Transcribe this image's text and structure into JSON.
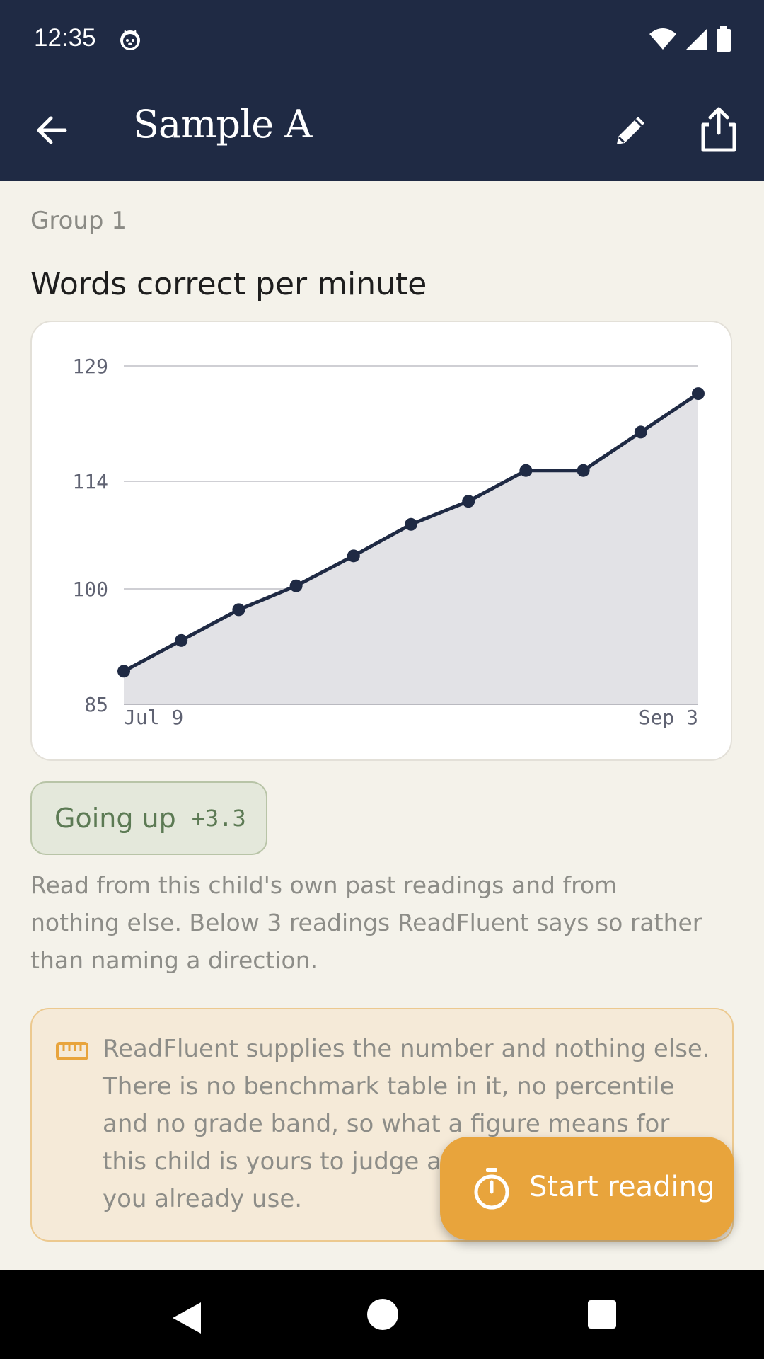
{
  "status": {
    "time": "12:35"
  },
  "appbar": {
    "title": "Sample A"
  },
  "group_label": "Group 1",
  "section_title": "Words correct per minute",
  "chart_data": {
    "type": "area",
    "title": "",
    "xlabel": "",
    "ylabel": "",
    "x_tick_labels": [
      "Jul 9",
      "Sep 3"
    ],
    "y_ticks": [
      85,
      100,
      114,
      129
    ],
    "ylim": [
      85,
      129
    ],
    "points": [
      {
        "x": "Jul 9",
        "y": 89.3
      },
      {
        "x": "Jul 14",
        "y": 93.3
      },
      {
        "x": "Jul 19",
        "y": 97.3
      },
      {
        "x": "Jul 24",
        "y": 100.4
      },
      {
        "x": "Jul 29",
        "y": 104.3
      },
      {
        "x": "Aug 3",
        "y": 108.4
      },
      {
        "x": "Aug 8",
        "y": 111.4
      },
      {
        "x": "Aug 13",
        "y": 115.4
      },
      {
        "x": "Aug 18",
        "y": 115.4
      },
      {
        "x": "Aug 23",
        "y": 120.4
      },
      {
        "x": "Sep 3",
        "y": 125.4
      }
    ],
    "grid": true,
    "colors": {
      "line": "#1f2a44",
      "fill": "#e2e2e6",
      "grid": "#cfcfd4"
    }
  },
  "trend": {
    "label": "Going up",
    "value": "+3.3"
  },
  "description": "Read from this child's own past readings and from nothing else. Below 3 readings ReadFluent says so rather than naming a direction.",
  "note": {
    "icon": "ruler-icon",
    "text": "ReadFluent supplies the number and nothing else. There is no benchmark table in it, no percentile and no grade band, so what a figure means for this child is yours to judge against the standard you already use."
  },
  "fab": {
    "label": "Start reading",
    "icon": "timer-icon"
  },
  "colors": {
    "appbar": "#1f2a44",
    "background": "#f4f2ea",
    "accent": "#e8a43c"
  }
}
